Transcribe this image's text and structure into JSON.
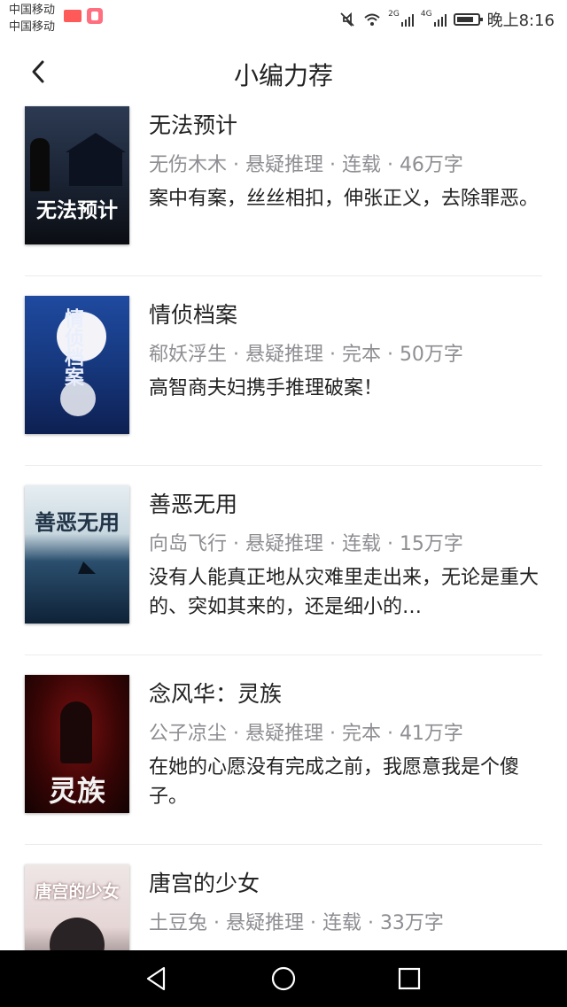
{
  "status_bar": {
    "carrier_1": "中国移动",
    "carrier_2": "中国移动",
    "net_2g": "2G",
    "net_4g": "4G",
    "time": "晚上8:16",
    "icons": [
      "mute-icon",
      "wifi-icon",
      "signal-icon",
      "battery-icon"
    ]
  },
  "header": {
    "title": "小编力荐",
    "back_icon": "chevron-left-icon"
  },
  "books": [
    {
      "title": "无法预计",
      "meta": "无伤木木 · 悬疑推理 · 连载 · 46万字",
      "description": "案中有案，丝丝相扣，伸张正义，去除罪恶。",
      "cover_text": "无法预计"
    },
    {
      "title": "情侦档案",
      "meta": "郗妖浮生 · 悬疑推理 · 完本 · 50万字",
      "description": "高智商夫妇携手推理破案！",
      "cover_text": "情侦档案"
    },
    {
      "title": "善恶无用",
      "meta": "向岛飞行 · 悬疑推理 · 连载 · 15万字",
      "description": "没有人能真正地从灾难里走出来，无论是重大的、突如其来的，还是细小的…",
      "cover_text": "善恶无用"
    },
    {
      "title": "念风华：灵族",
      "meta": "公子凉尘 · 悬疑推理 · 完本 · 41万字",
      "description": "在她的心愿没有完成之前，我愿意我是个傻子。",
      "cover_text": "灵族"
    },
    {
      "title": "唐宫的少女",
      "meta": "土豆兔 · 悬疑推理 · 连载 · 33万字",
      "description": "",
      "cover_text": "唐宫的少女"
    }
  ],
  "nav_bar": {
    "icons": [
      "back-triangle-icon",
      "home-circle-icon",
      "recent-square-icon"
    ]
  }
}
